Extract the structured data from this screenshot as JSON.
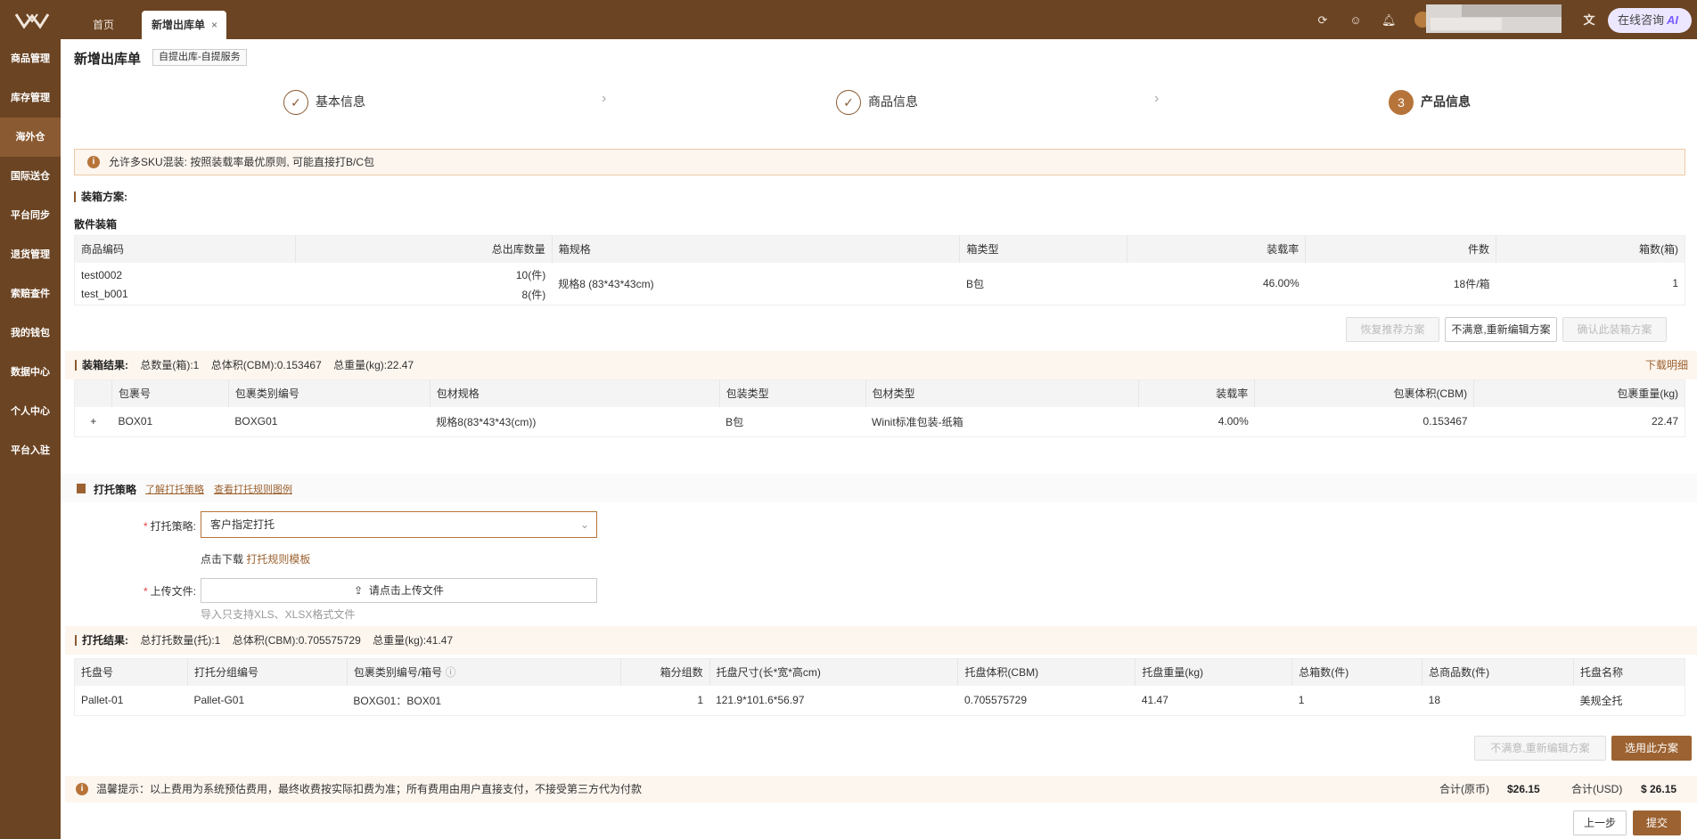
{
  "tabs": {
    "home": "首页",
    "active": "新增出库单",
    "close": "×"
  },
  "ai_button": {
    "label": "在线咨询",
    "badge": "AI"
  },
  "sidebar": {
    "items": [
      "商品管理",
      "库存管理",
      "海外仓",
      "国际送仓",
      "平台同步",
      "退货管理",
      "索赔查件",
      "我的钱包",
      "数据中心",
      "个人中心",
      "平台入驻"
    ],
    "active_index": 2
  },
  "page": {
    "title": "新增出库单",
    "tag": "自提出库-自提服务"
  },
  "steps": [
    {
      "label": "基本信息",
      "marker": "✓"
    },
    {
      "label": "商品信息",
      "marker": "✓"
    },
    {
      "label": "产品信息",
      "marker": "3"
    }
  ],
  "alert": "允许多SKU混装: 按照装载率最优原则, 可能直接打B/C包",
  "packing": {
    "title": "装箱方案:",
    "subtitle": "散件装箱",
    "headers": [
      "商品编码",
      "总出库数量",
      "箱规格",
      "箱类型",
      "装载率",
      "件数",
      "箱数(箱)"
    ],
    "skus": [
      {
        "code": "test0002",
        "qty": "10(件)"
      },
      {
        "code": "test_b001",
        "qty": "8(件)"
      }
    ],
    "spec": "规格8 (83*43*43cm)",
    "box_type": "B包",
    "rate": "46.00%",
    "pieces": "18件/箱",
    "boxes": "1",
    "buttons": {
      "restore": "恢复推荐方案",
      "reedit": "不满意,重新编辑方案",
      "confirm": "确认此装箱方案"
    }
  },
  "pack_result": {
    "title": "装箱结果:",
    "total_boxes": "总数量(箱):1",
    "total_volume": "总体积(CBM):0.153467",
    "total_weight": "总重量(kg):22.47",
    "download": "下载明细",
    "headers": [
      "包裹号",
      "包裹类别编号",
      "包材规格",
      "包装类型",
      "包材类型",
      "装载率",
      "包裹体积(CBM)",
      "包裹重量(kg)"
    ],
    "row": {
      "expand": "+",
      "id": "BOX01",
      "group": "BOXG01",
      "spec": "规格8(83*43*43(cm))",
      "type": "B包",
      "material": "Winit标准包装-纸箱",
      "rate": "4.00%",
      "volume": "0.153467",
      "weight": "22.47"
    }
  },
  "pallet_strategy": {
    "title": "打托策略",
    "link1": "了解打托策略",
    "link2": "查看打托规则图例",
    "strategy_label": "打托策略:",
    "strategy_value": "客户指定打托",
    "download_prefix": "点击下载",
    "download_link": "打托规则模板",
    "upload_label": "上传文件:",
    "upload_button": "请点击上传文件",
    "upload_hint": "导入只支持XLS、XLSX格式文件"
  },
  "pallet_result": {
    "title": "打托结果:",
    "total_pallets": "总打托数量(托):1",
    "total_volume": "总体积(CBM):0.705575729",
    "total_weight": "总重量(kg):41.47",
    "headers": [
      "托盘号",
      "打托分组编号",
      "包裹类别编号/箱号",
      "箱分组数",
      "托盘尺寸(长*宽*高cm)",
      "托盘体积(CBM)",
      "托盘重量(kg)",
      "总箱数(件)",
      "总商品数(件)",
      "托盘名称"
    ],
    "row": [
      "Pallet-01",
      "Pallet-G01",
      "BOXG01：BOX01",
      "1",
      "121.9*101.6*56.97",
      "0.705575729",
      "41.47",
      "1",
      "18",
      "美规全托"
    ],
    "buttons": {
      "reedit": "不满意,重新编辑方案",
      "select": "选用此方案"
    }
  },
  "footer": {
    "tip": "温馨提示：以上费用为系统预估费用，最终收费按实际扣费为准；所有费用由用户直接支付，不接受第三方代为付款",
    "total_orig_label": "合计(原币)",
    "total_orig": "$26.15",
    "total_usd_label": "合计(USD)",
    "total_usd": "$ 26.15",
    "prev": "上一步",
    "submit": "提交"
  }
}
